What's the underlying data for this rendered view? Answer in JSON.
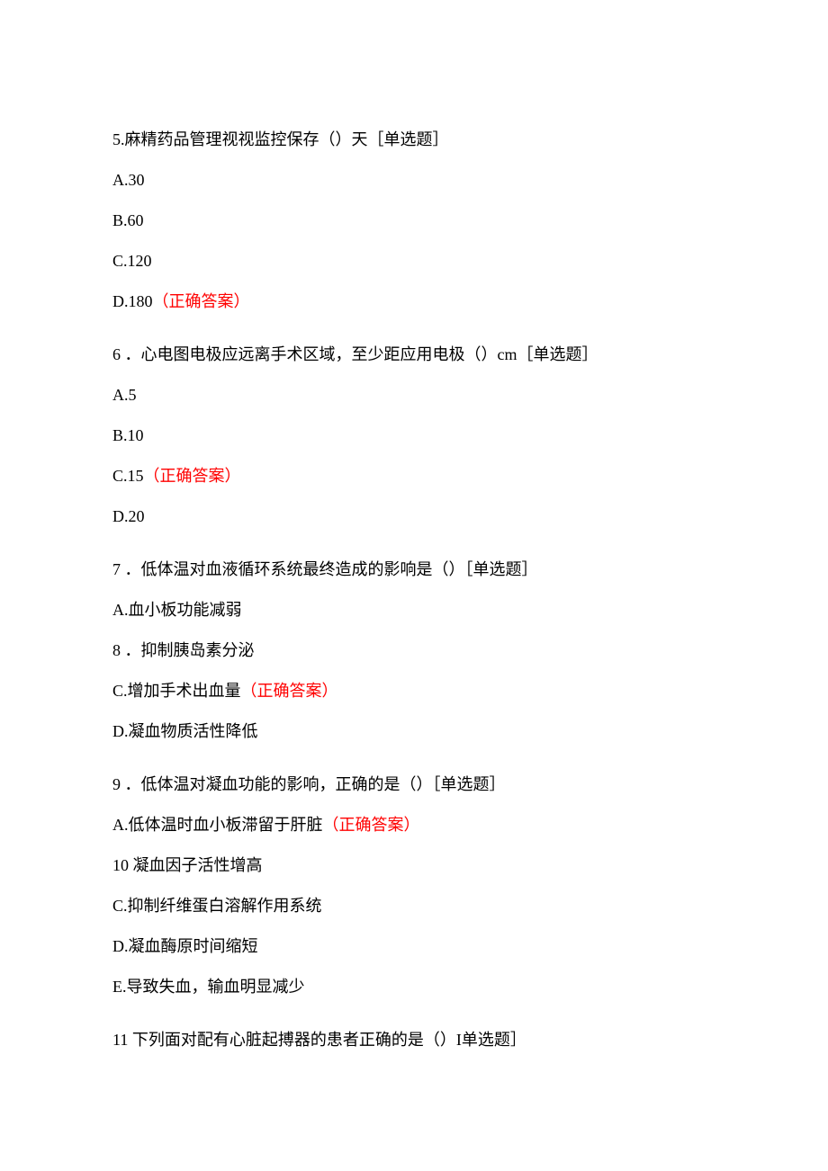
{
  "q5": {
    "stem": "5.麻精药品管理视视监控保存（）天［单选题］",
    "A": "A.30",
    "B": "B.60",
    "C": "C.120",
    "D_text": "D.180",
    "D_answer": "（正确答案）"
  },
  "q6": {
    "stem": "6 ．心电图电极应远离手术区域，至少距应用电极（）cm［单选题］",
    "A": "A.5",
    "B": "B.10",
    "C_text": "C.15",
    "C_answer": "（正确答案）",
    "D": "D.20"
  },
  "q7": {
    "stem": "7 ．低体温对血液循环系统最终造成的影响是（）［单选题］",
    "A": "A.血小板功能减弱",
    "B": "8 ．抑制胰岛素分泌",
    "C_text": "C.增加手术出血量",
    "C_answer": "（正确答案）",
    "D": "D.凝血物质活性降低"
  },
  "q9": {
    "stem": "9 ．低体温对凝血功能的影响，正确的是（）［单选题］",
    "A_text": "A.低体温时血小板滞留于肝脏",
    "A_answer": "（正确答案）",
    "B": "10  凝血因子活性增高",
    "C": "C.抑制纤维蛋白溶解作用系统",
    "D": "D.凝血酶原时间缩短",
    "E": "E.导致失血，输血明显减少"
  },
  "q11": {
    "stem": "11  下列面对配有心脏起搏器的患者正确的是（）I单选题］"
  }
}
